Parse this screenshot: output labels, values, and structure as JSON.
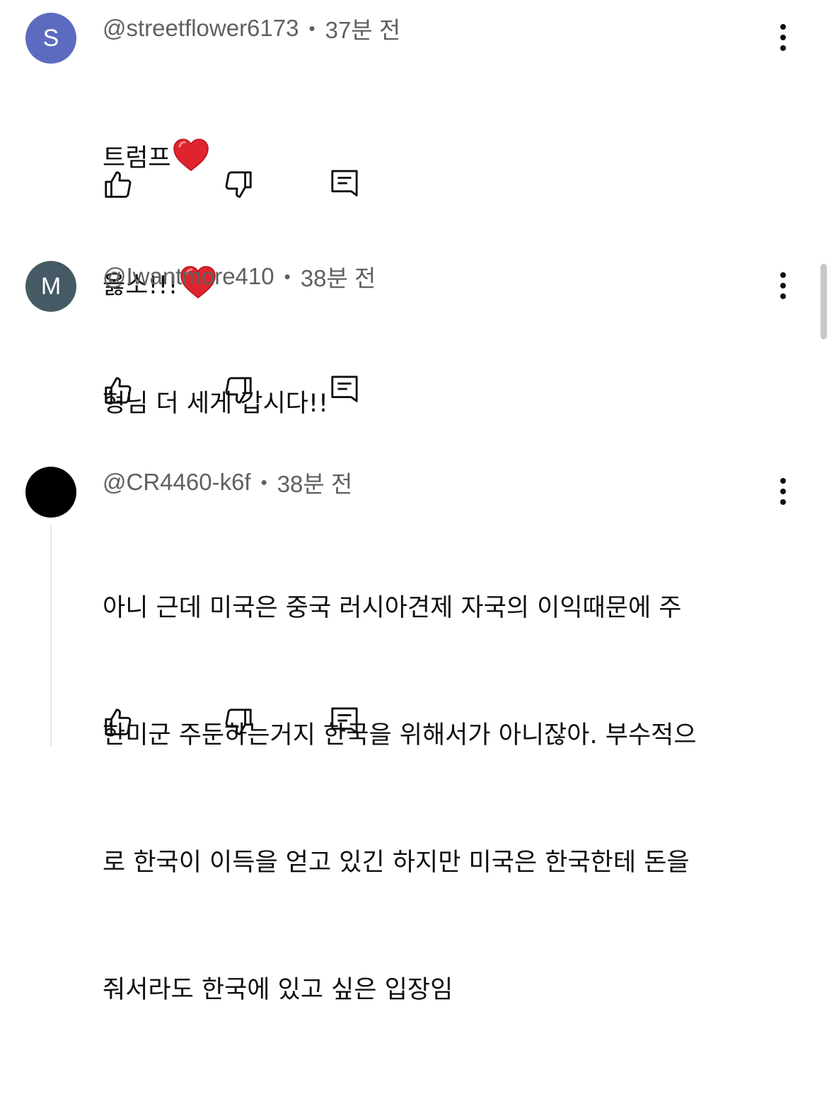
{
  "comments": [
    {
      "avatar_letter": "S",
      "avatar_color": "#5c6bc0",
      "username": "@streetflower6173",
      "time": "37분 전",
      "lines": [
        "트럼프",
        "옳소!!!"
      ]
    },
    {
      "avatar_letter": "M",
      "avatar_color": "#455a64",
      "username": "@Iwantmore410",
      "time": "38분 전",
      "lines": [
        "형님 더 세게 갑시다!!"
      ]
    },
    {
      "avatar_letter": "",
      "avatar_color": "#000000",
      "username": "@CR4460-k6f",
      "time": "38분 전",
      "lines": [
        "아니 근데 미국은 중국 러시아견제 자국의 이익때문에 주",
        "한미군 주둔하는거지 한국을 위해서가 아니잖아. 부수적으",
        "로 한국이 이득을 얻고 있긴 하지만 미국은 한국한테 돈을",
        "줘서라도 한국에 있고 싶은 입장임"
      ]
    }
  ],
  "separator": "•",
  "icons": {
    "like": "thumbs-up-icon",
    "dislike": "thumbs-down-icon",
    "reply": "reply-comment-icon",
    "more": "more-vertical-icon",
    "emoji": "red-heart-emoji"
  }
}
